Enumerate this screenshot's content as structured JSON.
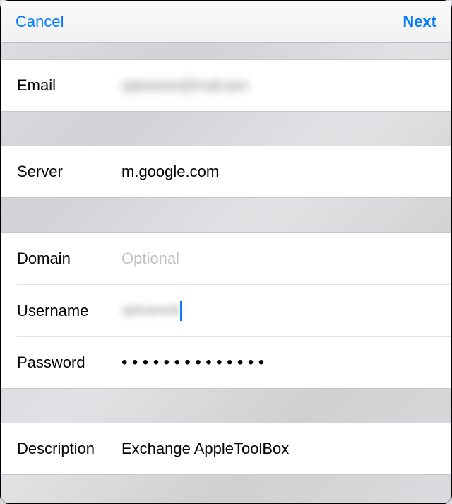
{
  "header": {
    "cancel_label": "Cancel",
    "next_label": "Next"
  },
  "fields": {
    "email": {
      "label": "Email",
      "value_obscured": "aptoanes@mail.aon"
    },
    "server": {
      "label": "Server",
      "value": "m.google.com"
    },
    "domain": {
      "label": "Domain",
      "placeholder": "Optional",
      "value": ""
    },
    "username": {
      "label": "Username",
      "value_obscured": "aptoanesk"
    },
    "password": {
      "label": "Password",
      "mask": "••••••••••••••"
    },
    "description": {
      "label": "Description",
      "value": "Exchange AppleToolBox"
    }
  }
}
